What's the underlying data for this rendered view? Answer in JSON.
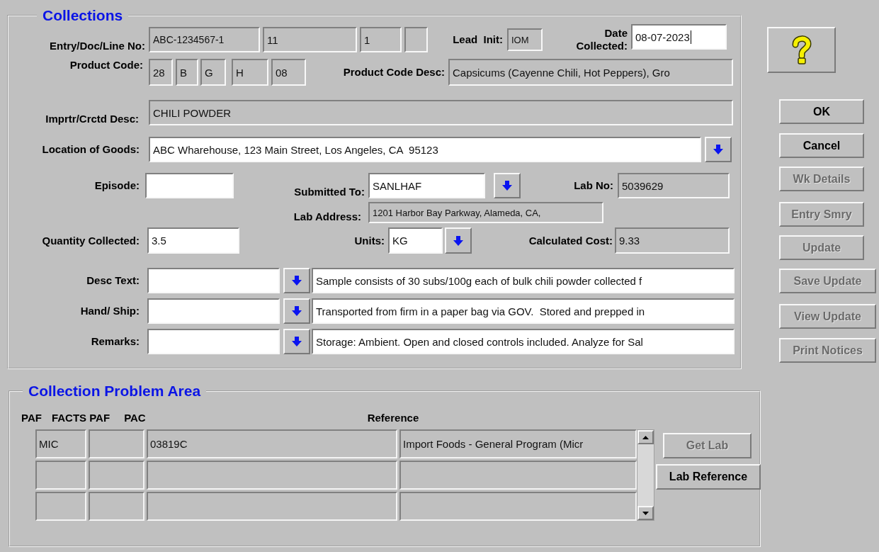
{
  "collections": {
    "title": "Collections",
    "entry_doc_line": {
      "label": "Entry/Doc/Line No:",
      "fields": [
        {
          "value": "ABC-1234567-1",
          "readonly": true
        },
        {
          "value": "11",
          "readonly": true
        },
        {
          "value": "1",
          "readonly": true
        },
        {
          "readonly": true
        }
      ]
    },
    "lead_init": {
      "label": "Lead  Init:",
      "value": "IOM",
      "readonly": true
    },
    "date_collected": {
      "label": "Date Collected:",
      "value": "08-07-2023",
      "readonly": false,
      "focused": true
    },
    "product_code": {
      "label": "Product Code:",
      "fields": [
        {
          "value": "28",
          "readonly": true
        },
        {
          "value": "B",
          "readonly": true
        },
        {
          "value": "G",
          "readonly": true
        },
        {
          "value": "H",
          "readonly": true
        },
        {
          "value": "08",
          "readonly": true
        }
      ]
    },
    "product_code_desc": {
      "label": "Product Code Desc:",
      "value": "Capsicums (Cayenne Chili, Hot Peppers), Gro",
      "readonly": true
    },
    "imprtr_crctd_desc": {
      "label": "Imprtr/Crctd Desc:",
      "value": "CHILI POWDER",
      "readonly": true
    },
    "location_of_goods": {
      "label": "Location of Goods:",
      "value": "ABC Wharehouse, 123 Main Street, Los Angeles, CA  95123",
      "readonly": false
    },
    "episode": {
      "label": "Episode:",
      "readonly": false
    },
    "submitted_to": {
      "label": "Submitted To:",
      "value": "SANLHAF",
      "readonly": false
    },
    "lab_no": {
      "label": "Lab No:",
      "value": "5039629",
      "readonly": true
    },
    "lab_address": {
      "label": "Lab Address:",
      "value": "1201 Harbor Bay Parkway, Alameda, CA,",
      "readonly": true
    },
    "quantity_collected": {
      "label": "Quantity Collected:",
      "value": "3.5",
      "readonly": false
    },
    "units": {
      "label": "Units:",
      "value": "KG",
      "readonly": false
    },
    "calculated_cost": {
      "label": "Calculated Cost:",
      "value": "9.33",
      "readonly": true
    },
    "text_rows": [
      {
        "label": "Desc Text:",
        "code_readonly": false,
        "text": "Sample consists of 30 subs/100g each of bulk chili powder collected f",
        "text_readonly": false
      },
      {
        "label": "Hand/ Ship:",
        "code_readonly": false,
        "text": "Transported from firm in a paper bag via GOV.  Stored and prepped in",
        "text_readonly": false
      },
      {
        "label": "Remarks:",
        "code_readonly": false,
        "text": "Storage: Ambient. Open and closed controls included. Analyze for Sal",
        "text_readonly": false
      }
    ]
  },
  "problem_area": {
    "title": "Collection Problem Area",
    "columns": [
      "PAF",
      "FACTS PAF",
      "PAC",
      "Reference"
    ],
    "rows": [
      {
        "cells": [
          "MIC",
          null,
          "03819C",
          "Import Foods - General Program (Micr"
        ]
      },
      {
        "cells": [
          null,
          null,
          null,
          null
        ]
      },
      {
        "cells": [
          null,
          null,
          null,
          null
        ]
      }
    ],
    "buttons": [
      {
        "label": "Get Lab",
        "disabled": true
      },
      {
        "label": "Lab Reference",
        "disabled": false
      }
    ]
  },
  "side_buttons": [
    {
      "label": "OK",
      "disabled": false
    },
    {
      "label": "Cancel",
      "disabled": false
    },
    {
      "label": "Wk Details",
      "disabled": true
    },
    {
      "label": "Entry Smry",
      "disabled": true
    },
    {
      "label": "Update",
      "disabled": true
    },
    {
      "label": "Save Update",
      "disabled": true
    },
    {
      "label": "View Update",
      "disabled": true
    },
    {
      "label": "Print Notices",
      "disabled": true
    }
  ]
}
